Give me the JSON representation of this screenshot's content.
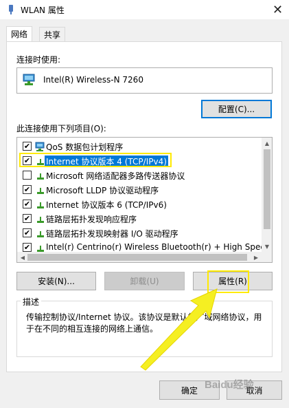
{
  "window": {
    "title": "WLAN 属性",
    "close_glyph": "✕"
  },
  "tabs": [
    {
      "label": "网络",
      "active": true
    },
    {
      "label": "共享",
      "active": false
    }
  ],
  "connection": {
    "connect_using_label": "连接时使用:",
    "adapter_name": "Intel(R) Wireless-N 7260",
    "configure_button": "配置(C)..."
  },
  "items": {
    "label": "此连接使用下列项目(O):",
    "list": [
      {
        "checked": true,
        "text": "QoS 数据包计划程序",
        "icon": "qos-network-icon",
        "selected": false
      },
      {
        "checked": true,
        "text": "Internet 协议版本 4 (TCP/IPv4)",
        "icon": "protocol-icon",
        "selected": true
      },
      {
        "checked": false,
        "text": "Microsoft 网络适配器多路传送器协议",
        "icon": "protocol-icon",
        "selected": false
      },
      {
        "checked": true,
        "text": "Microsoft LLDP 协议驱动程序",
        "icon": "protocol-icon",
        "selected": false
      },
      {
        "checked": true,
        "text": "Internet 协议版本 6 (TCP/IPv6)",
        "icon": "protocol-icon",
        "selected": false
      },
      {
        "checked": true,
        "text": "链路层拓扑发现响应程序",
        "icon": "protocol-icon",
        "selected": false
      },
      {
        "checked": true,
        "text": "链路层拓扑发现映射器 I/O 驱动程序",
        "icon": "protocol-icon",
        "selected": false
      },
      {
        "checked": true,
        "text": "Intel(r) Centrino(r) Wireless Bluetooth(r) + High Speed",
        "icon": "protocol-icon",
        "selected": false
      }
    ],
    "check_glyph": "✔"
  },
  "actions": {
    "install": "安装(N)...",
    "uninstall": "卸载(U)",
    "properties": "属性(R)"
  },
  "description": {
    "title": "描述",
    "text": "传输控制协议/Internet 协议。该协议是默认的广域网络协议，用于在不同的相互连接的网络上通信。"
  },
  "footer": {
    "ok": "确定",
    "cancel": "取消"
  },
  "watermark": "Baidu经验",
  "colors": {
    "selection": "#0078d7",
    "highlight": "#ffea00",
    "protocol_icon_green": "#3a9a2a"
  }
}
